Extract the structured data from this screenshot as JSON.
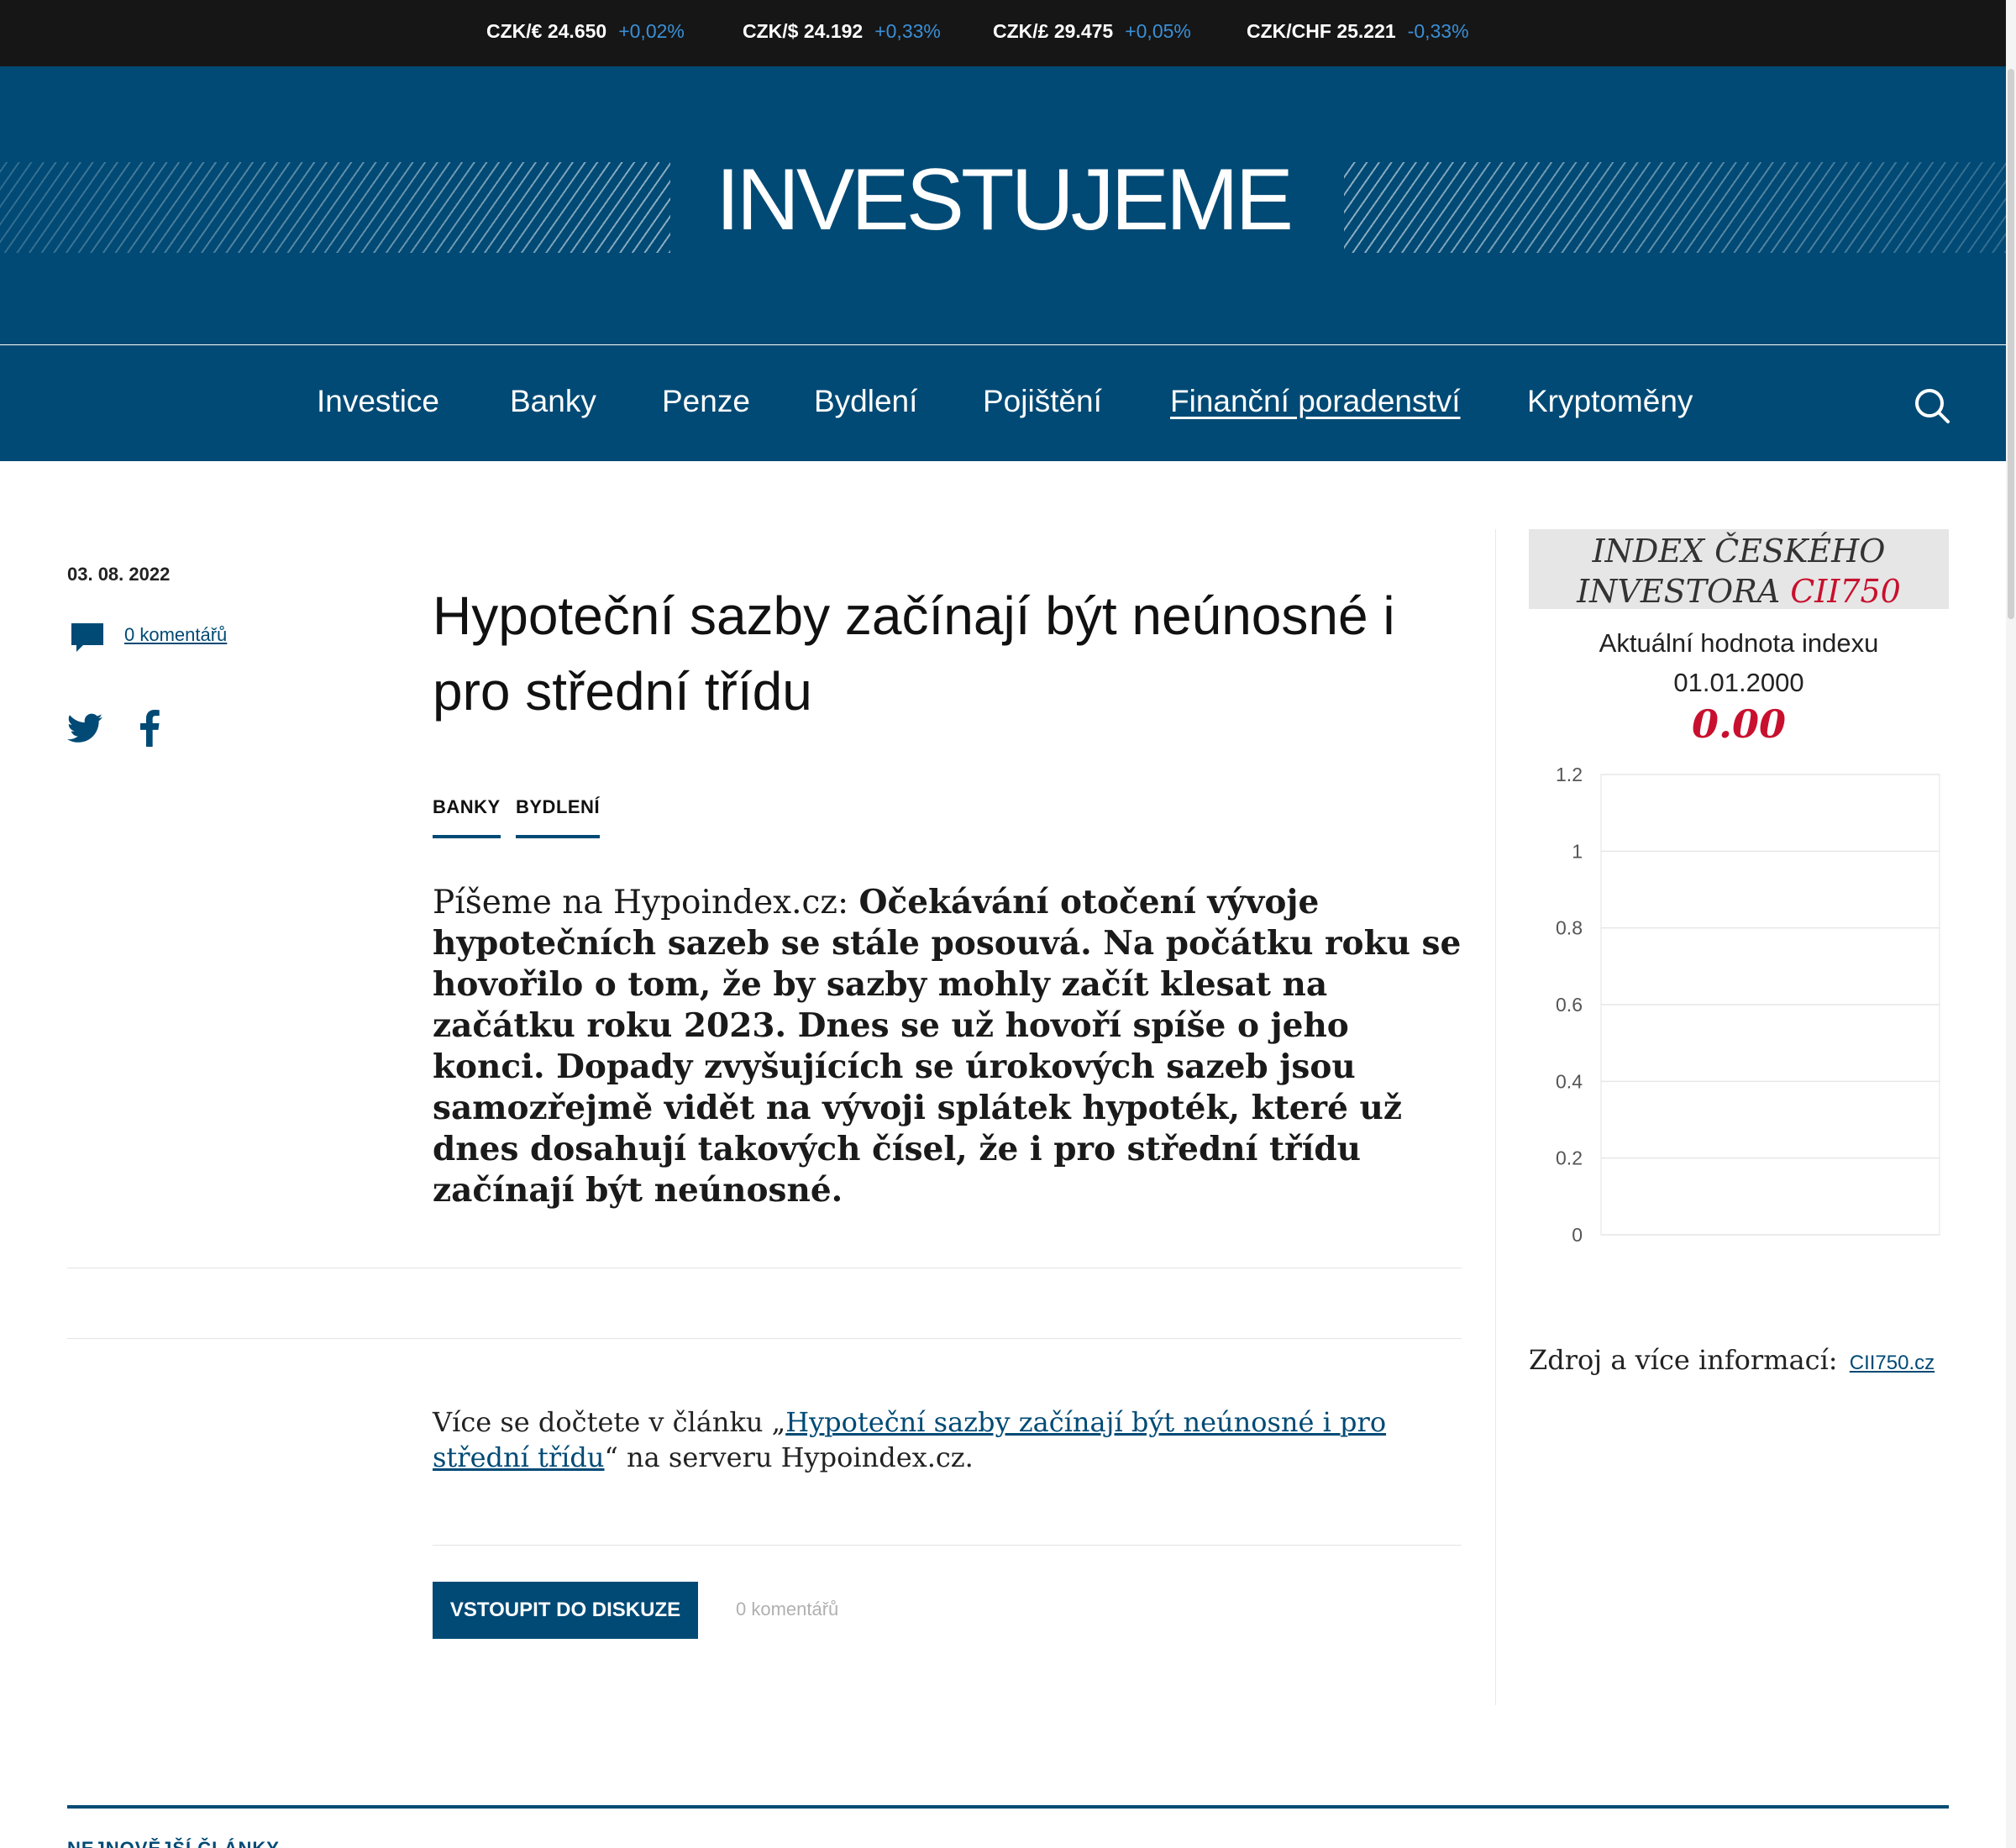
{
  "ticker": [
    {
      "pair": "CZK/€ 24.650",
      "change": "+0,02%",
      "color": "#3a8fd6"
    },
    {
      "pair": "CZK/$ 24.192",
      "change": "+0,33%",
      "color": "#3a8fd6"
    },
    {
      "pair": "CZK/£ 29.475",
      "change": "+0,05%",
      "color": "#3a8fd6"
    },
    {
      "pair": "CZK/CHF 25.221",
      "change": "-0,33%",
      "color": "#3a8fd6"
    }
  ],
  "brand": {
    "logo": "INVESTUJEME",
    "primary_color": "#004a75"
  },
  "nav": {
    "items": [
      "Investice",
      "Banky",
      "Penze",
      "Bydlení",
      "Pojištění",
      "Finanční poradenství",
      "Kryptoměny"
    ],
    "active": "Finanční poradenství",
    "search_icon": "search-icon"
  },
  "article": {
    "date": "03. 08. 2022",
    "comments_link": "0 komentářů",
    "title": "Hypoteční sazby začínají být neúnosné i pro střední třídu",
    "tags": [
      "BANKY",
      "BYDLENÍ"
    ],
    "perex_lead": "Píšeme na Hypoindex.cz: ",
    "perex_body": "Očekávání otočení vývoje hypotečních sazeb se stále posouvá. Na počátku roku se hovořilo o tom, že by sazby mohly začít klesat na začátku roku 2023. Dnes se už hovoří spíše o jeho konci. Dopady zvyšujících se úrokových sazeb jsou samozřejmě vidět na vývoji splátek hypoték, které už dnes dosahují takových čísel, že i pro střední třídu začínají být neúnosné.",
    "more_prefix": "Více se dočtete v článku „",
    "more_link": "Hypoteční sazby začínají být neúnosné i pro střední třídu",
    "more_suffix": "“ na serveru Hypoindex.cz.",
    "discuss_button": "VSTOUPIT DO DISKUZE",
    "discuss_count": "0 komentářů"
  },
  "sidebar": {
    "index_title_line1": "INDEX ČESKÉHO",
    "index_title_line2_prefix": "INVESTORA ",
    "index_title_code": "CII750",
    "current_label": "Aktuální hodnota indexu",
    "current_date": "01.01.2000",
    "current_value": "0.00",
    "source_label": "Zdroj a více informací:",
    "source_link": "CII750.cz"
  },
  "chart_data": {
    "type": "line",
    "x": [],
    "series": [],
    "title": "",
    "xlabel": "",
    "ylabel": "",
    "ylim": [
      0,
      1.2
    ],
    "yticks": [
      "1.2",
      "1",
      "0.8",
      "0.6",
      "0.4",
      "0.2",
      "0"
    ],
    "grid": true
  },
  "footer": {
    "peek_text": "NEJNOVĚJŠÍ ČLÁNKY"
  }
}
